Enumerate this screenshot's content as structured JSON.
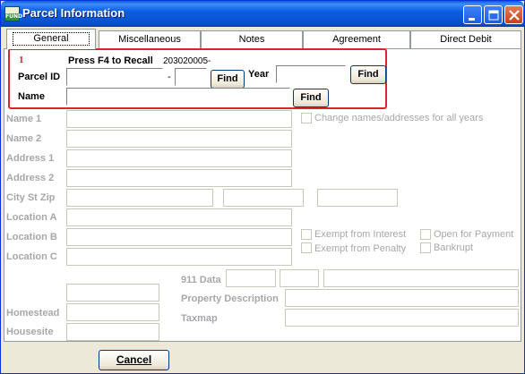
{
  "window": {
    "title": "Parcel Information",
    "app_icon_text": "FUND"
  },
  "tabs": [
    {
      "label": "General",
      "selected": true
    },
    {
      "label": "Miscellaneous"
    },
    {
      "label": "Notes"
    },
    {
      "label": "Agreement"
    },
    {
      "label": "Direct Debit"
    }
  ],
  "annotation": {
    "step_number": "1",
    "color": "#d9262a"
  },
  "recall": {
    "hint": "Press F4 to Recall",
    "parcel_number": "203020005-"
  },
  "fields": {
    "parcel_id_label": "Parcel ID",
    "parcel_id_sep": "-",
    "year_label": "Year",
    "name_label": "Name",
    "name1_label": "Name 1",
    "name2_label": "Name 2",
    "address1_label": "Address 1",
    "address2_label": "Address 2",
    "city_label": "City St Zip",
    "locA_label": "Location A",
    "locB_label": "Location B",
    "locC_label": "Location C",
    "homestead_label": "Homestead",
    "housesite_label": "Housesite",
    "data911_label": "911 Data",
    "propdesc_label": "Property Description",
    "taxmap_label": "Taxmap"
  },
  "buttons": {
    "find": "Find",
    "cancel": "Cancel"
  },
  "checkboxes": {
    "change_names": "Change names/addresses for all years",
    "exempt_interest": "Exempt from Interest",
    "exempt_penalty": "Exempt from Penalty",
    "open_payment": "Open for Payment",
    "bankrupt": "Bankrupt"
  }
}
